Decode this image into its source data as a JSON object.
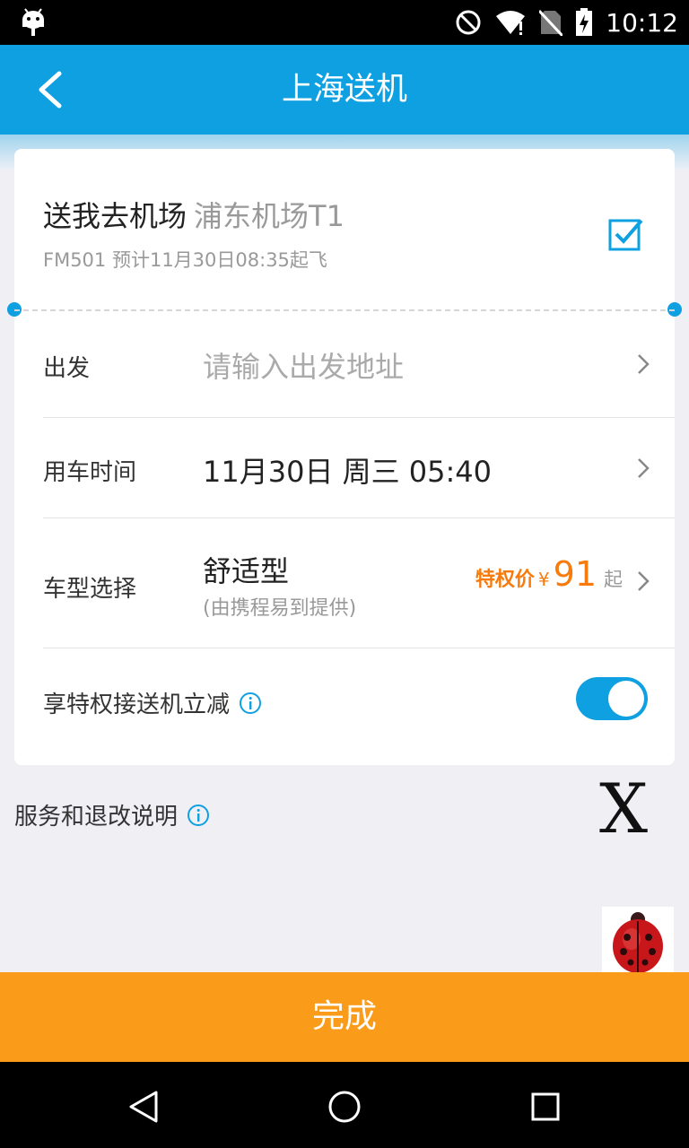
{
  "status_bar": {
    "time": "10:12",
    "icons": [
      "android-icon",
      "do-not-disturb-icon",
      "wifi-icon",
      "no-sim-icon",
      "battery-charging-icon"
    ]
  },
  "header": {
    "title": "上海送机"
  },
  "flight": {
    "title": "送我去机场",
    "airport": "浦东机场T1",
    "info": "FM501 预计11月30日08:35起飞",
    "checked": true
  },
  "form": {
    "departure": {
      "label": "出发",
      "placeholder": "请输入出发地址"
    },
    "time": {
      "label": "用车时间",
      "value": "11月30日 周三 05:40"
    },
    "car": {
      "label": "车型选择",
      "value": "舒适型",
      "sub": "(由携程易到提供)",
      "price_label": "特权价",
      "currency": "¥",
      "price": "91",
      "price_suffix": "起"
    },
    "privilege": {
      "label": "享特权接送机立减",
      "enabled": true
    }
  },
  "service": {
    "label": "服务和退改说明"
  },
  "overlay": {
    "close_text": "X"
  },
  "footer": {
    "done_label": "完成"
  },
  "colors": {
    "primary": "#0ea0e1",
    "accent": "#fb9b1a",
    "price": "#f77b0c"
  }
}
